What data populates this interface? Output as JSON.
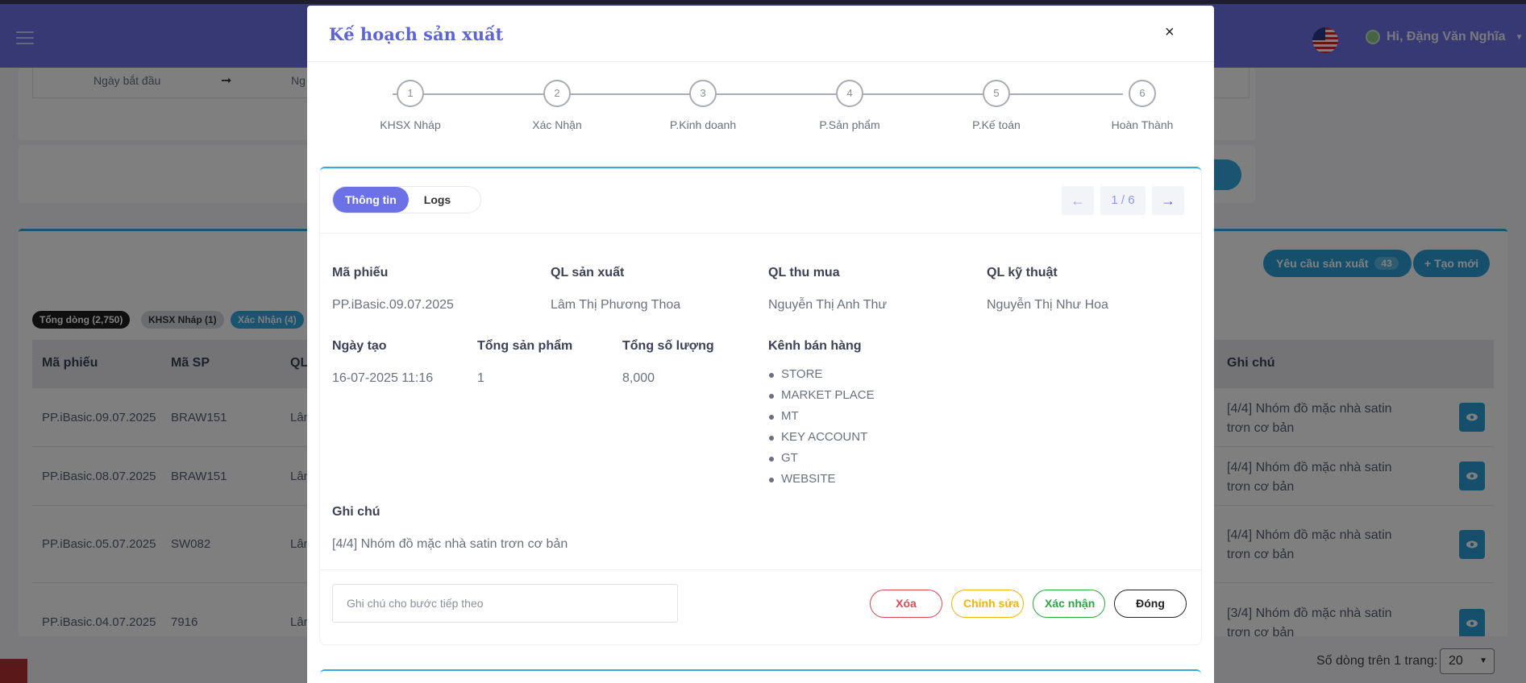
{
  "app": {
    "user_greeting": "Hi, Đặng Văn Nghĩa"
  },
  "filter": {
    "start_date_label": "Ngày bắt đầu",
    "end_date_label_partial": "Ng"
  },
  "list": {
    "pills": [
      "Tổng dòng (2,750)",
      "KHSX Nháp (1)",
      "Xác Nhận (4)"
    ],
    "request_button": {
      "label": "Yêu cầu sản xuất",
      "count": "43"
    },
    "new_button": "Tạo mới",
    "columns": [
      "Mã phiếu",
      "Mã SP",
      "QL",
      "Ghi chú"
    ],
    "rows": [
      {
        "code": "PP.iBasic.09.07.2025",
        "sku": "BRAW151",
        "ql": "Lân",
        "note": "[4/4] Nhóm đồ mặc nhà satin trơn cơ bản"
      },
      {
        "code": "PP.iBasic.08.07.2025",
        "sku": "BRAW151",
        "ql": "Lân",
        "note": "[4/4] Nhóm đồ mặc nhà satin trơn cơ bản"
      },
      {
        "code": "PP.iBasic.05.07.2025",
        "sku": "SW082",
        "ql": "Lân",
        "note": "[4/4] Nhóm đồ mặc nhà satin trơn cơ bản"
      },
      {
        "code": "PP.iBasic.04.07.2025",
        "sku": "7916",
        "ql": "Lân",
        "note": "[3/4] Nhóm đồ mặc nhà satin trơn cơ bản"
      }
    ],
    "rows_per_page_label": "Số dòng trên 1 trang:",
    "rows_per_page_value": "20"
  },
  "modal": {
    "title": "Kế hoạch sản xuất",
    "close": "×",
    "steps": [
      {
        "num": "1",
        "label": "KHSX Nháp"
      },
      {
        "num": "2",
        "label": "Xác Nhận"
      },
      {
        "num": "3",
        "label": "P.Kinh doanh"
      },
      {
        "num": "4",
        "label": "P.Sản phẩm"
      },
      {
        "num": "5",
        "label": "P.Kế toán"
      },
      {
        "num": "6",
        "label": "Hoàn Thành"
      }
    ],
    "tabs": {
      "info": "Thông tin",
      "logs": "Logs"
    },
    "pager": {
      "info": "1 / 6",
      "prev": "←",
      "next": "→"
    },
    "fields": {
      "ma_phieu": {
        "label": "Mã phiếu",
        "value": "PP.iBasic.09.07.2025"
      },
      "ql_san_xuat": {
        "label": "QL sản xuất",
        "value": "Lâm Thị Phương Thoa"
      },
      "ql_thu_mua": {
        "label": "QL thu mua",
        "value": "Nguyễn Thị Anh Thư"
      },
      "ql_ky_thuat": {
        "label": "QL kỹ thuật",
        "value": "Nguyễn Thị Như Hoa"
      },
      "ngay_tao": {
        "label": "Ngày tạo",
        "value": "16-07-2025 11:16"
      },
      "tong_san_pham": {
        "label": "Tổng sản phẩm",
        "value": "1"
      },
      "tong_so_luong": {
        "label": "Tổng số lượng",
        "value": "8,000"
      },
      "kenh_ban_hang": {
        "label": "Kênh bán hàng",
        "values": [
          "STORE",
          "MARKET PLACE",
          "MT",
          "KEY ACCOUNT",
          "GT",
          "WEBSITE"
        ]
      },
      "ghi_chu": {
        "label": "Ghi chú",
        "value": "[4/4] Nhóm đồ mặc nhà satin trơn cơ bản"
      }
    },
    "next_step_note": {
      "placeholder": "Ghi chú cho bước tiếp theo",
      "value": ""
    },
    "actions": {
      "delete": "Xóa",
      "edit": "Chỉnh sửa",
      "confirm": "Xác nhận",
      "close": "Đóng"
    }
  }
}
